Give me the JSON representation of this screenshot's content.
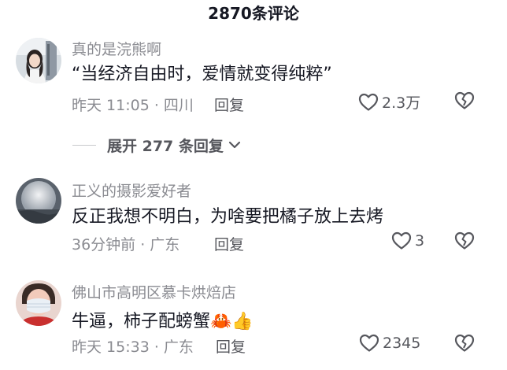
{
  "header": {
    "title": "2870条评论"
  },
  "comments": [
    {
      "username": "真的是浣熊啊",
      "content": "“当经济自由时，爱情就变得纯粹”",
      "meta": "昨天 11:05 · 四川",
      "reply_label": "回复",
      "like_count": "2.3万",
      "avatar_icon": "avatar-girl-photo"
    },
    {
      "username": "正义的摄影爱好者",
      "content": "反正我想不明白，为啥要把橘子放上去烤",
      "meta": "36分钟前 · 广东",
      "reply_label": "回复",
      "like_count": "3",
      "avatar_icon": "avatar-moon-photo"
    },
    {
      "username": "佛山市高明区慕卡烘焙店",
      "content": "牛逼，柿子配螃蟹🦀👍",
      "meta": "昨天 15:33 · 广东",
      "reply_label": "回复",
      "like_count": "2345",
      "avatar_icon": "avatar-masked-person-photo"
    }
  ],
  "expand_replies": {
    "label": "展开 277 条回复"
  },
  "icons": {
    "like": "heart-outline-icon",
    "dislike": "broken-heart-icon",
    "expand": "chevron-down-icon"
  },
  "colors": {
    "primary_text": "#161823",
    "secondary_text": "#8a8b91",
    "action_text": "#56575d"
  }
}
